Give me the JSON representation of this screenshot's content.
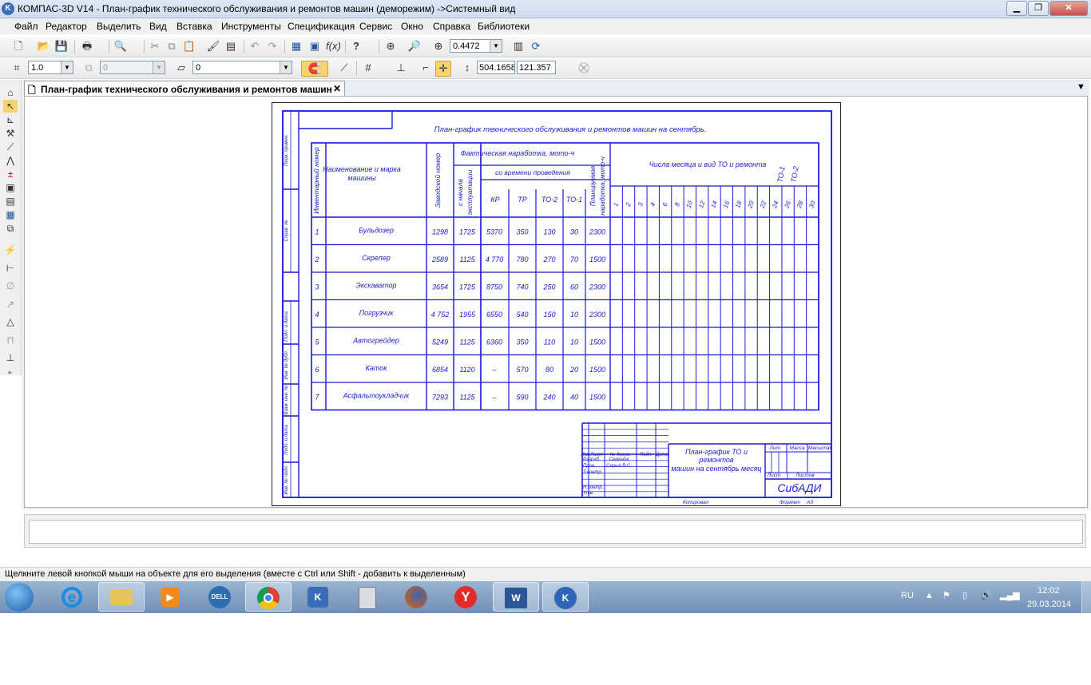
{
  "window": {
    "title": "КОМПАС-3D V14 - План-график технического обслуживания и ремонтов машин (деморежим) ->Системный вид",
    "app_icon": "kompas-logo-icon",
    "controls": [
      "minimize-icon",
      "restore-icon",
      "close-icon"
    ]
  },
  "menu": [
    "Файл",
    "Редактор",
    "Выделить",
    "Вид",
    "Вставка",
    "Инструменты",
    "Спецификация",
    "Сервис",
    "Окно",
    "Справка",
    "Библиотеки"
  ],
  "toolbar1": {
    "zoom": "0.4472"
  },
  "toolbar2": {
    "line_width": "1.0",
    "layer": "0",
    "style": "0",
    "coord_x": "504.1658",
    "coord_y": "121.357"
  },
  "document_tab": {
    "label": "План-график технического обслуживания и ремонтов машин"
  },
  "drawing": {
    "title": "План-график технического обслуживания и ремонтов машин на сентябрь.",
    "headers": {
      "inv": "Инвентарный номер",
      "name": "Наименование и марка машины",
      "factory": "Заводской номер",
      "actual": "Фактическая наработка, мото-ч",
      "since_start": "с начала эксплуатации",
      "since_last": "со времени проведения",
      "kr": "КР",
      "tr": "ТР",
      "to2": "ТО-2",
      "to1": "ТО-1",
      "planned": "Планируемая наработка, мото-ч",
      "days": "Числа месяца и вид ТО и ремонта",
      "legend_to1": "ТО-1",
      "legend_to2": "ТО-2"
    },
    "day_numbers": [
      "1",
      "2",
      "3",
      "4",
      "6",
      "8",
      "10",
      "12",
      "14",
      "16",
      "18",
      "20",
      "22",
      "24",
      "26",
      "28",
      "30"
    ],
    "rows": [
      {
        "n": "1",
        "name": "Бульдозер",
        "factory": "1298",
        "start": "1725",
        "kr": "5370",
        "tr": "350",
        "to2": "130",
        "to1": "30",
        "plan": "2300"
      },
      {
        "n": "2",
        "name": "Скрепер",
        "factory": "2589",
        "start": "1125",
        "kr": "4 770",
        "tr": "780",
        "to2": "270",
        "to1": "70",
        "plan": "1500"
      },
      {
        "n": "3",
        "name": "Экскаватор",
        "factory": "3654",
        "start": "1725",
        "kr": "8750",
        "tr": "740",
        "to2": "250",
        "to1": "60",
        "plan": "2300"
      },
      {
        "n": "4",
        "name": "Погрузчик",
        "factory": "4 752",
        "start": "1955",
        "kr": "6550",
        "tr": "540",
        "to2": "150",
        "to1": "10",
        "plan": "2300"
      },
      {
        "n": "5",
        "name": "Автогрейдер",
        "factory": "5249",
        "start": "1125",
        "kr": "6360",
        "tr": "350",
        "to2": "110",
        "to1": "10",
        "plan": "1500"
      },
      {
        "n": "6",
        "name": "Каток",
        "factory": "6854",
        "start": "1120",
        "kr": "–",
        "tr": "570",
        "to2": "80",
        "to1": "20",
        "plan": "1500"
      },
      {
        "n": "7",
        "name": "Асфальтоукладчик",
        "factory": "7293",
        "start": "1125",
        "kr": "–",
        "tr": "590",
        "to2": "240",
        "to1": "40",
        "plan": "1500"
      }
    ],
    "side_labels": [
      "Перв. примен.",
      "Справ. №",
      "Подп. и дата",
      "Инв. № дубл.",
      "Взам. инв. №",
      "Подп. и дата",
      "Инв. № подл."
    ],
    "stamp": {
      "cols": [
        "Изм",
        "Лист",
        "№ докум.",
        "Подп.",
        "Дата"
      ],
      "roles": [
        "Разраб.",
        "Пров.",
        "Т.контр.",
        "Н.контр.",
        "Утв."
      ],
      "names": [
        "Семенов",
        "Серых В.С."
      ],
      "doc_title": "План-график ТО и ремонтов машин на сентябрь месяц",
      "lit": "Лит.",
      "mass": "Масса",
      "scale": "Масштаб",
      "sheet": "Лист",
      "sheets": "Листов",
      "org": "СибАДИ",
      "copied": "Копировал",
      "format": "Формат",
      "format_value": "А3"
    }
  },
  "status": {
    "message": "Щелкните левой кнопкой мыши на объекте для его выделения (вместе с Ctrl или Shift - добавить к выделенным)"
  },
  "taskbar": {
    "apps": [
      "start-orb-icon",
      "internet-explorer-icon",
      "explorer-folder-icon",
      "media-player-icon",
      "dell-icon",
      "chrome-icon",
      "kompas-icon",
      "calculator-icon",
      "firefox-icon",
      "yandex-icon",
      "word-icon",
      "kompas-3d-icon"
    ],
    "lang": "RU",
    "time": "12:02",
    "date": "29.03.2014"
  }
}
